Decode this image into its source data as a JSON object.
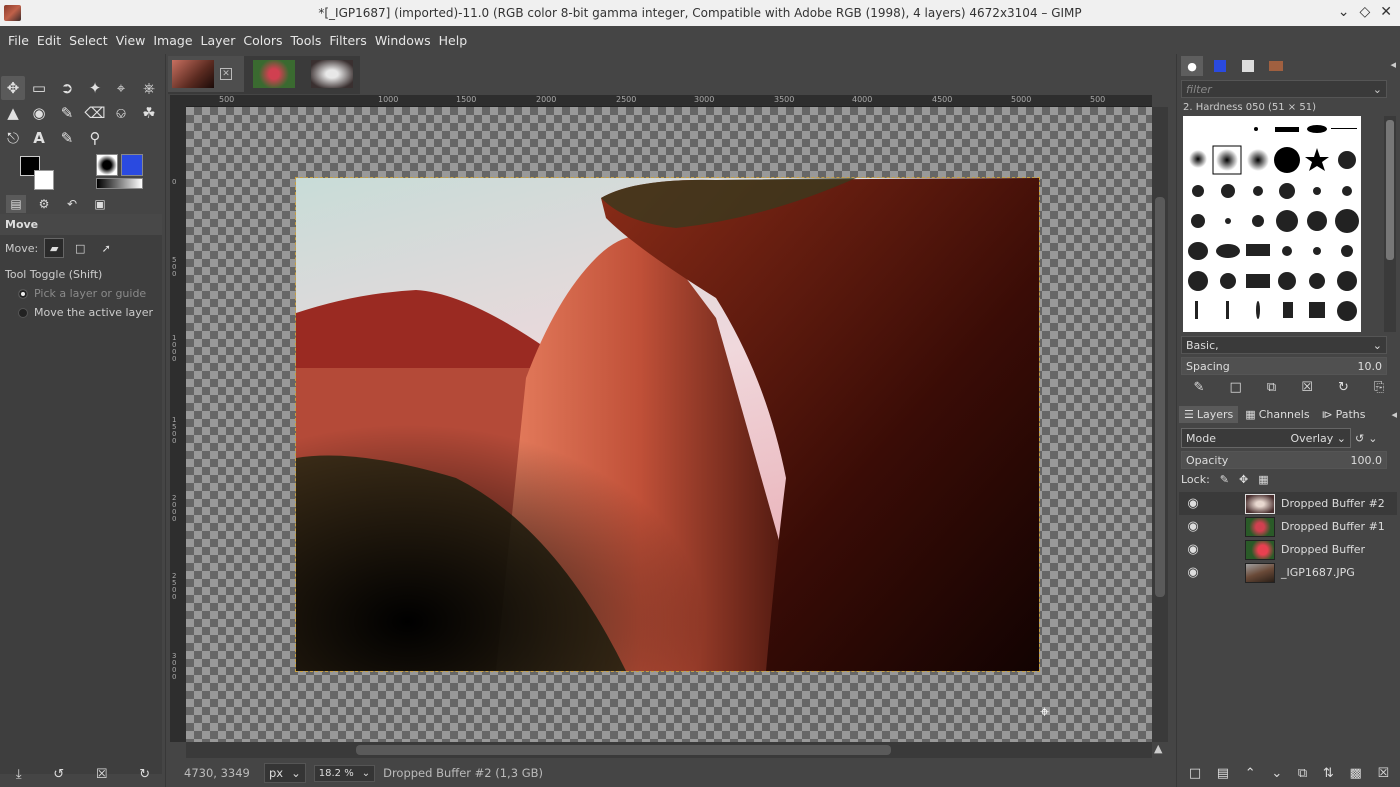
{
  "window": {
    "title": "*[_IGP1687] (imported)-11.0 (RGB color 8-bit gamma integer, Compatible with Adobe RGB (1998), 4 layers) 4672x3104 – GIMP"
  },
  "menu": [
    "File",
    "Edit",
    "Select",
    "View",
    "Image",
    "Layer",
    "Colors",
    "Tools",
    "Filters",
    "Windows",
    "Help"
  ],
  "tool_options": {
    "title": "Move",
    "move_label": "Move:",
    "toggle_label": "Tool Toggle  (Shift)",
    "option1": "Pick a layer or guide",
    "option2": "Move the active layer"
  },
  "ruler": {
    "h_labels": [
      "500",
      "500",
      "1000",
      "1500",
      "2000",
      "2500",
      "3000",
      "3500",
      "4000",
      "4500",
      "5000"
    ],
    "v_labels": [
      "0",
      "5 0 0",
      "1 0 0 0",
      "1 5 0 0",
      "2 0 0 0",
      "2 5 0 0",
      "3 0 0 0"
    ]
  },
  "status": {
    "coords": "4730, 3349",
    "unit": "px",
    "zoom": "18.2 %",
    "message": "Dropped Buffer #2 (1,3 GB)"
  },
  "brushes": {
    "filter_placeholder": "filter",
    "current": "2. Hardness 050 (51 × 51)",
    "set": "Basic,",
    "spacing_label": "Spacing",
    "spacing_value": "10.0"
  },
  "layers_panel": {
    "tabs": [
      "Layers",
      "Channels",
      "Paths"
    ],
    "mode_label": "Mode",
    "mode_value": "Overlay",
    "opacity_label": "Opacity",
    "opacity_value": "100.0",
    "lock_label": "Lock:",
    "layers": [
      {
        "name": "Dropped Buffer #2",
        "visible": true,
        "selected": true
      },
      {
        "name": "Dropped Buffer #1",
        "visible": true,
        "selected": false
      },
      {
        "name": "Dropped Buffer",
        "visible": true,
        "selected": false
      },
      {
        "name": "_IGP1687.JPG",
        "visible": true,
        "selected": false
      }
    ]
  },
  "colors": {
    "fg": "#000000",
    "bg": "#ffffff",
    "pattern": "#2a4ae0",
    "selection_outline": "#c8a040"
  }
}
